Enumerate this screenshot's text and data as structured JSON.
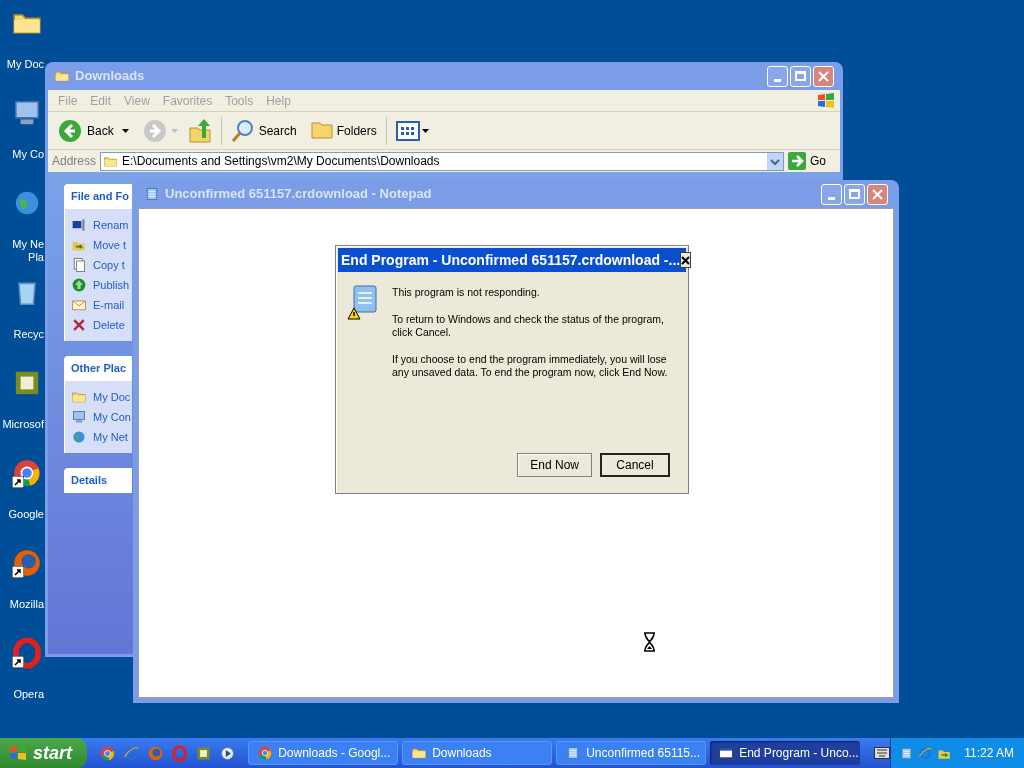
{
  "desktop_icons": [
    {
      "kind": "folder",
      "label": "My Doc",
      "shortcut": false
    },
    {
      "kind": "computer",
      "label": "My Co",
      "shortcut": false
    },
    {
      "kind": "globe",
      "label": "My Ne\nPla",
      "shortcut": false
    },
    {
      "kind": "recycle",
      "label": "Recyc",
      "shortcut": false
    },
    {
      "kind": "app",
      "label": "Microsof",
      "shortcut": false
    },
    {
      "kind": "chrome",
      "label": "Google",
      "shortcut": true
    },
    {
      "kind": "firefox",
      "label": "Mozilla",
      "shortcut": true
    },
    {
      "kind": "opera",
      "label": "Opera",
      "shortcut": true
    }
  ],
  "explorer": {
    "title": "Downloads",
    "active": false,
    "menu": [
      {
        "label": "File",
        "disabled": true
      },
      {
        "label": "Edit",
        "disabled": true
      },
      {
        "label": "View",
        "disabled": true
      },
      {
        "label": "Favorites",
        "disabled": true
      },
      {
        "label": "Tools",
        "disabled": true
      },
      {
        "label": "Help",
        "disabled": true
      }
    ],
    "toolbar": {
      "back": "Back",
      "search": "Search",
      "folders": "Folders",
      "forward_disabled": true
    },
    "address": {
      "label": "Address",
      "value": "E:\\Documents and Settings\\vm2\\My Documents\\Downloads",
      "go": "Go"
    },
    "panels": [
      {
        "title": "File and Fo",
        "items": [
          {
            "kind": "rename",
            "label": "Renam"
          },
          {
            "kind": "move",
            "label": "Move t"
          },
          {
            "kind": "copy",
            "label": "Copy t"
          },
          {
            "kind": "publish",
            "label": "Publish"
          },
          {
            "kind": "email",
            "label": "E-mail"
          },
          {
            "kind": "delete",
            "label": "Delete"
          }
        ]
      },
      {
        "title": "Other Plac",
        "items": [
          {
            "kind": "docs",
            "label": "My Doc"
          },
          {
            "kind": "computer",
            "label": "My Con"
          },
          {
            "kind": "network",
            "label": "My Net"
          }
        ]
      },
      {
        "title": "Details"
      }
    ]
  },
  "notepad": {
    "title": "Unconfirmed 651157.crdownload - Notepad",
    "active": false
  },
  "dialog": {
    "title": "End Program - Unconfirmed 651157.crdownload -...",
    "paragraphs": [
      "This program is not responding.",
      "To return to Windows and check the status of the program, click Cancel.",
      "If you choose to end the program immediately, you will lose any unsaved data. To end the program now, click End Now."
    ],
    "buttons": [
      {
        "label": "End Now",
        "default": false
      },
      {
        "label": "Cancel",
        "default": true
      }
    ]
  },
  "taskbar": {
    "start": "start",
    "quick_launch": [
      {
        "kind": "chrome"
      },
      {
        "kind": "ie"
      },
      {
        "kind": "firefox"
      },
      {
        "kind": "opera"
      },
      {
        "kind": "app"
      },
      {
        "kind": "media"
      }
    ],
    "tasks": [
      {
        "kind": "chrome",
        "label": "Downloads - Googl...",
        "selected": false
      },
      {
        "kind": "folder",
        "label": "Downloads",
        "selected": false
      },
      {
        "kind": "notepad",
        "label": "Unconfirmed 65115...",
        "selected": false
      },
      {
        "kind": "window",
        "label": "End Program - Unco...",
        "selected": true
      }
    ],
    "clock": "11:22 AM"
  }
}
